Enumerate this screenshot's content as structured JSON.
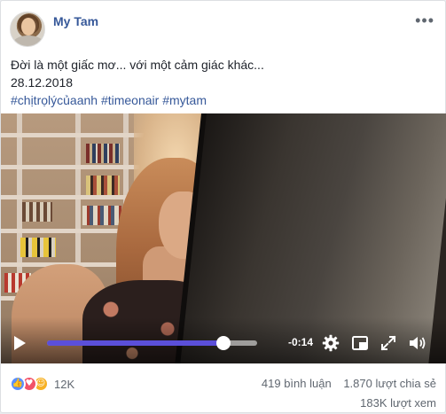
{
  "post": {
    "author": "My Tam",
    "more_label": "•••",
    "text_line": "Đời là một giấc mơ... với một cảm giác khác...",
    "date": "28.12.2018",
    "hashtags": "#chịtrọlýcủaanh #timeonair #mytam"
  },
  "video": {
    "time_remaining": "-0:14",
    "progress": 0.84,
    "icons": [
      "play-icon",
      "settings-icon",
      "pip-icon",
      "fullscreen-icon",
      "volume-icon"
    ]
  },
  "footer": {
    "reactions": [
      "like-reaction-icon",
      "love-reaction-icon",
      "haha-reaction-icon"
    ],
    "reaction_count": "12K",
    "comments": "419 bình luận",
    "shares": "1.870 lượt chia sẻ",
    "views": "183K lượt xem"
  },
  "colors": {
    "author_blue": "#365899",
    "progress_purple": "#5b4fd9",
    "like_blue": "#5890ff",
    "love_red": "#f25268",
    "haha_yellow": "#f7b125"
  }
}
